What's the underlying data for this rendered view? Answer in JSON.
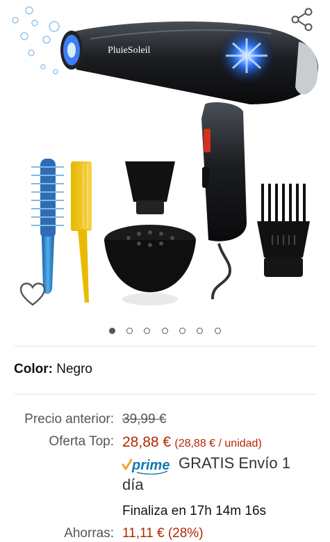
{
  "product": {
    "brand_on_image": "PluieSoleil",
    "images_count": 7,
    "active_image_index": 0
  },
  "details": {
    "color_label": "Color:",
    "color_value": "Negro"
  },
  "pricing": {
    "previous_label": "Precio anterior:",
    "previous_price": "39,99 €",
    "offer_label": "Oferta Top:",
    "offer_price": "28,88 €",
    "unit_price": "(28,88 € / unidad)",
    "prime_logo": "prime",
    "shipping_line1": "GRATIS Envío 1",
    "shipping_line2": "día",
    "ends_in": "Finaliza en 17h 14m 16s",
    "savings_label": "Ahorras:",
    "savings_value": "11,11 € (28%)"
  },
  "colors": {
    "price_red": "#b12704",
    "prime_blue": "#0f79af",
    "prime_check": "#f0a42a"
  },
  "icons": {
    "share": "share-icon",
    "wishlist": "heart-icon"
  }
}
